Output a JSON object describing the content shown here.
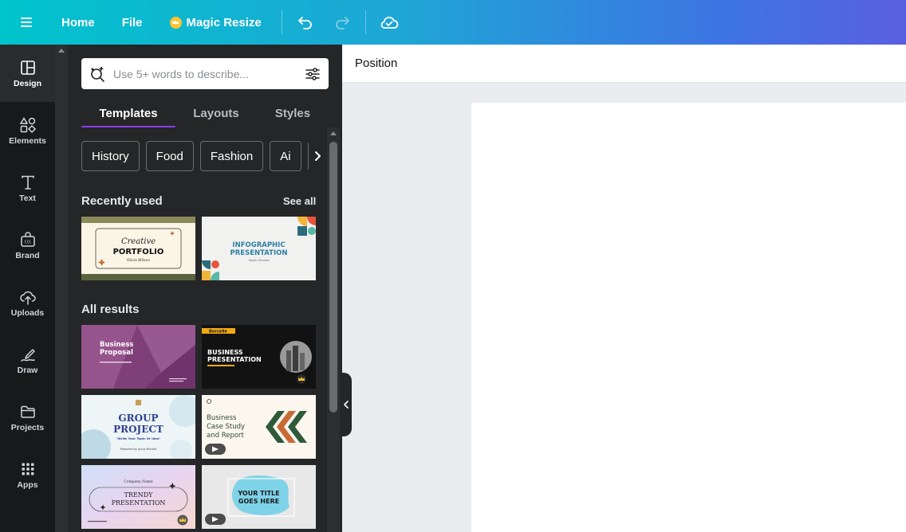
{
  "topbar": {
    "home": "Home",
    "file": "File",
    "magic_resize": "Magic Resize",
    "colors": {
      "accent_start": "#00c4cc",
      "accent_end": "#5a5fe0",
      "crown": "#ffc431"
    }
  },
  "rail": {
    "items": [
      {
        "label": "Design",
        "icon": "layout-icon"
      },
      {
        "label": "Elements",
        "icon": "shapes-icon"
      },
      {
        "label": "Text",
        "icon": "text-icon"
      },
      {
        "label": "Brand",
        "icon": "brand-icon"
      },
      {
        "label": "Uploads",
        "icon": "cloud-upload-icon"
      },
      {
        "label": "Draw",
        "icon": "pen-icon"
      },
      {
        "label": "Projects",
        "icon": "folder-icon"
      },
      {
        "label": "Apps",
        "icon": "grid-icon"
      }
    ]
  },
  "panel": {
    "search_placeholder": "Use 5+ words to describe...",
    "tabs": [
      "Templates",
      "Layouts",
      "Styles"
    ],
    "chips": [
      "History",
      "Food",
      "Fashion",
      "Ai"
    ],
    "recently_used": "Recently used",
    "see_all": "See all",
    "all_results": "All results",
    "accent": "#8b3dff"
  },
  "thumbs": {
    "creative": {
      "script": "Creative",
      "title": "PORTFOLIO",
      "name": "Olivia Wilson"
    },
    "infographic": {
      "line1": "INFOGRAPHIC",
      "line2": "PRESENTATION",
      "sub": "Studio Shodwe"
    },
    "biz_proposal": {
      "line1": "Business",
      "line2": "Proposal"
    },
    "biz_presentation": {
      "brand": "Borcelle",
      "line1": "BUSINESS",
      "line2": "PRESENTATION"
    },
    "group_project": {
      "line1": "GROUP",
      "line2": "PROJECT",
      "sub": "\"Write Your Topic Or Idea\"",
      "credit": "Presented by: group Borcelle"
    },
    "case_study": {
      "line1": "Business",
      "line2": "Case Study",
      "line3": "and Report"
    },
    "trendy": {
      "company": "Company Name",
      "line1": "TRENDY",
      "line2": "PRESENTATION"
    },
    "your_title": {
      "line1": "YOUR TITLE",
      "line2": "GOES HERE"
    }
  },
  "editor": {
    "position": "Position"
  }
}
